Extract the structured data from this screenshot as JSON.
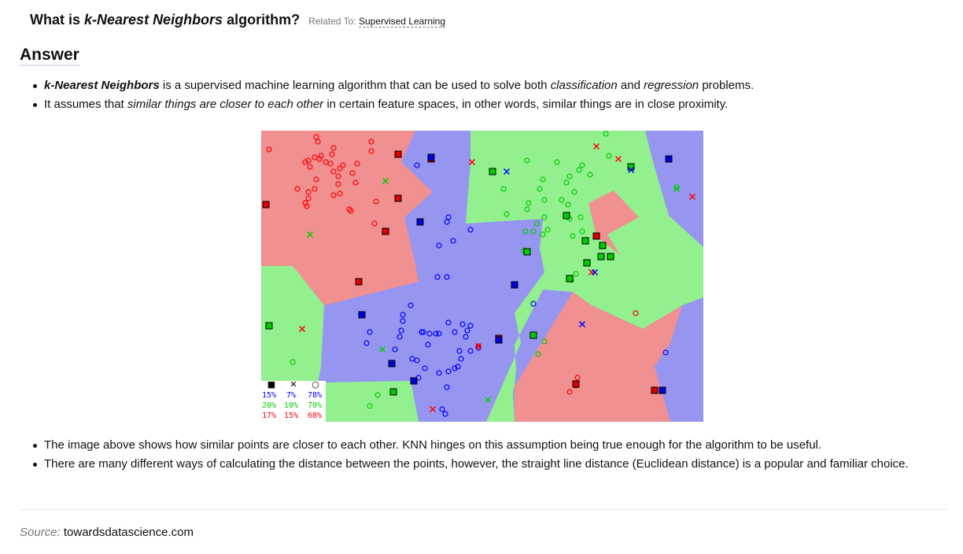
{
  "question": {
    "prefix": "What is ",
    "term": "k-Nearest Neighbors",
    "suffix": " algorithm?",
    "related_label": "Related To:",
    "related_topic": "Supervised Learning"
  },
  "answer_heading": "Answer",
  "bullets_top": [
    {
      "parts": [
        "k-Nearest Neighbors",
        " is a supervised machine learning algorithm that can be used to solve both ",
        "classification",
        " and ",
        "regression",
        " problems."
      ]
    },
    {
      "parts": [
        "It assumes that ",
        "similar things are closer to each other",
        " in certain feature spaces, in other words, similar things are in close proximity."
      ]
    }
  ],
  "figure": {
    "colors": {
      "red": "#f09090",
      "blue": "#9696f0",
      "green": "#93f08f",
      "red_point": "#ff0000",
      "blue_point": "#0000ff",
      "green_point": "#00cc00"
    },
    "legend": {
      "symbols": [
        "■",
        "✕",
        "○"
      ],
      "rows": [
        {
          "color": "#0000ff",
          "values": [
            "15%",
            "7%",
            "78%"
          ]
        },
        {
          "color": "#00cc00",
          "values": [
            "20%",
            "10%",
            "70%"
          ]
        },
        {
          "color": "#ff0000",
          "values": [
            "17%",
            "15%",
            "68%"
          ]
        }
      ]
    }
  },
  "bullets_bottom": [
    "The image above shows how similar points are closer to each other. KNN hinges on this assumption being true enough for the algorithm to be useful.",
    "There are many different ways of calculating the distance between the points, however, the straight line distance (Euclidean distance) is a popular and familiar choice."
  ],
  "source": {
    "label": "Source:",
    "site": "towardsdatascience.com"
  }
}
